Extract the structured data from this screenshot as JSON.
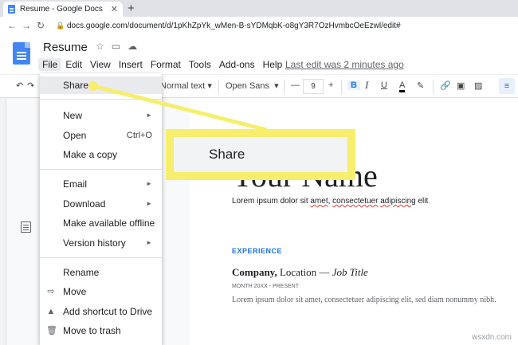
{
  "browser": {
    "tab_title": "Resume - Google Docs",
    "tab_close": "✕",
    "new_tab": "+",
    "url": "docs.google.com/document/d/1pKhZpYk_wMen-B-sYDMqbK-o8gY3R7OzHvmbcOeEzwl/edit#"
  },
  "doc": {
    "title": "Resume",
    "menus": [
      "File",
      "Edit",
      "View",
      "Insert",
      "Format",
      "Tools",
      "Add-ons",
      "Help"
    ],
    "last_edit": "Last edit was 2 minutes ago"
  },
  "toolbar": {
    "style": "Normal text",
    "font": "Open Sans",
    "size": "9",
    "minus": "—",
    "plus": "+",
    "bold": "B",
    "italic": "I",
    "underline": "U",
    "text_color": "A"
  },
  "file_menu": {
    "share": "Share",
    "new": "New",
    "open": "Open",
    "open_shortcut": "Ctrl+O",
    "make_copy": "Make a copy",
    "email": "Email",
    "download": "Download",
    "offline": "Make available offline",
    "version_history": "Version history",
    "rename": "Rename",
    "move": "Move",
    "add_shortcut": "Add shortcut to Drive",
    "trash": "Move to trash"
  },
  "callout": {
    "label": "Share"
  },
  "document": {
    "heading": "Your Name",
    "subtitle_a": "Lorem ipsum dolor sit ",
    "subtitle_b": "amet",
    "subtitle_c": ", ",
    "subtitle_d": "consectetuer",
    "subtitle_e": " ",
    "subtitle_f": "adipiscing",
    "subtitle_g": " elit",
    "section": "EXPERIENCE",
    "company": "Company,",
    "location": " Location — ",
    "job_title": "Job Title",
    "month": "MONTH 20XX - PRESENT",
    "body": "Lorem ipsum dolor sit amet, consectetuer adipiscing elit, sed diam nonummy nibh."
  },
  "watermark": "wsxdn.com",
  "colors": {
    "highlight": "#f6ee6c",
    "accent": "#1a73e8",
    "docs_blue": "#4285f4"
  }
}
